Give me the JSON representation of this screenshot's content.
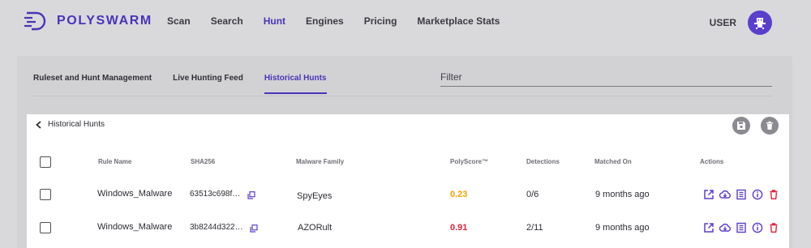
{
  "brand": {
    "name": "POLYSWARM",
    "color": "#4b33b8"
  },
  "nav": {
    "items": [
      {
        "label": "Scan"
      },
      {
        "label": "Search"
      },
      {
        "label": "Hunt",
        "active": true
      },
      {
        "label": "Engines"
      },
      {
        "label": "Pricing"
      },
      {
        "label": "Marketplace Stats"
      }
    ]
  },
  "user": {
    "label": "USER"
  },
  "tabs": [
    {
      "label": "Ruleset and Hunt Management"
    },
    {
      "label": "Live Hunting Feed"
    },
    {
      "label": "Historical Hunts",
      "active": true
    }
  ],
  "filter": {
    "placeholder": "Filter"
  },
  "panel": {
    "back_label": "Historical Hunts",
    "save_icon": "save-icon",
    "delete_icon": "trash-icon"
  },
  "table": {
    "headers": {
      "rule_name": "Rule Name",
      "sha256": "SHA256",
      "malware_family": "Malware Family",
      "polyscore": "PolyScore™",
      "detections": "Detections",
      "matched_on": "Matched On",
      "actions": "Actions"
    },
    "rows": [
      {
        "rule_name": "Windows_Malware",
        "sha256": "63513c698f…",
        "malware_family": "SpyEyes",
        "polyscore": "0.23",
        "polyscore_color": "#f5a300",
        "detections": "0/6",
        "matched_on": "9 months ago"
      },
      {
        "rule_name": "Windows_Malware",
        "sha256": "3b8244d322…",
        "malware_family": "AZORult",
        "polyscore": "0.91",
        "polyscore_color": "#e0243a",
        "detections": "2/11",
        "matched_on": "9 months ago"
      }
    ],
    "action_icons": [
      "open-external-icon",
      "cloud-download-icon",
      "report-icon",
      "info-icon",
      "delete-icon"
    ]
  },
  "colors": {
    "accent": "#5a3fcc",
    "danger": "#e0243a",
    "warning": "#f5a300"
  }
}
